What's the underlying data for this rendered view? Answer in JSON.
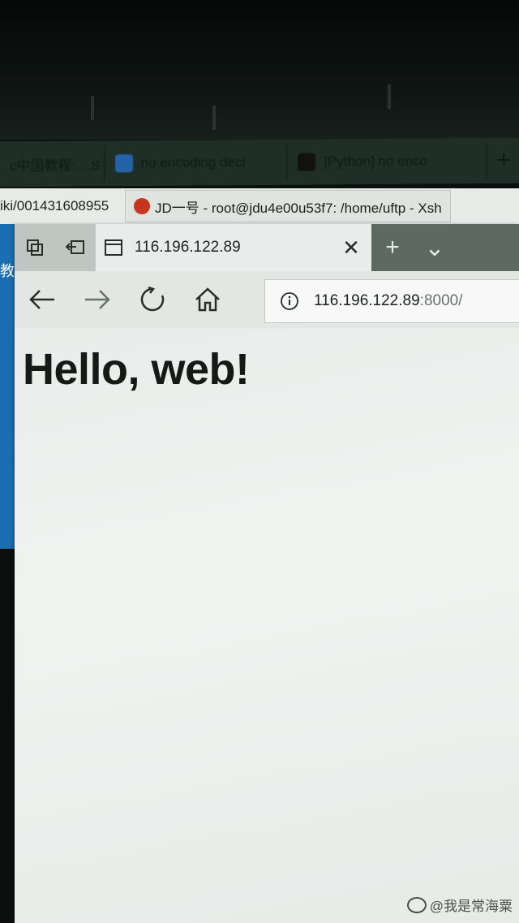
{
  "background_tabs": [
    {
      "label": "c中国教程: ...S",
      "icon": "page-icon",
      "color": "#1f2f27"
    },
    {
      "label": "no encoding decl",
      "icon": "paw-icon",
      "color": "#2463a8"
    },
    {
      "label": "[Python] no enco",
      "icon": "csdn-c-icon",
      "color": "#111"
    }
  ],
  "background_plus": "+",
  "under_window": {
    "url_fragment": "iki/001431608955",
    "terminal_title": "JD一号 - root@jdu4e00u53f7: /home/uftp - Xsh"
  },
  "left_strip_char": "教",
  "edge": {
    "tab_title": "116.196.122.89",
    "tab_close": "✕",
    "new_tab": "+",
    "tab_menu": "⌄",
    "address_host": "116.196.122.89",
    "address_port": ":8000/",
    "page_heading": "Hello, web!"
  },
  "watermark": "@我是常海粟",
  "colors": {
    "accent_blue": "#1a6fb2",
    "terminal_icon": "#c8351f"
  }
}
